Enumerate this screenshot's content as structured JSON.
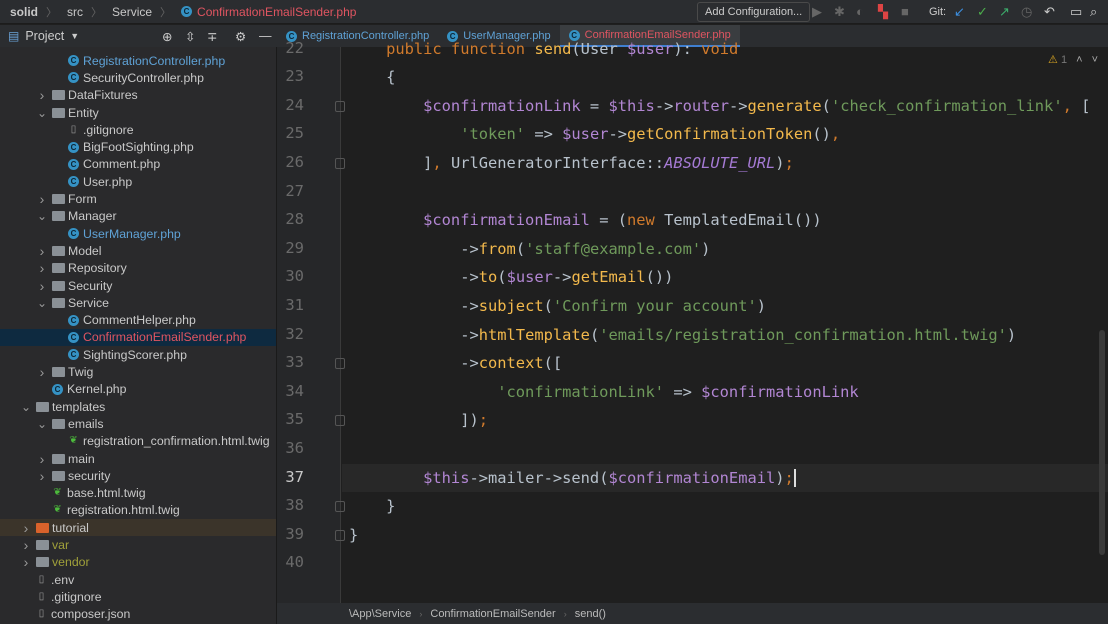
{
  "breadcrumb": [
    "solid",
    "src",
    "Service",
    "ConfirmationEmailSender.php"
  ],
  "toolbar": {
    "add_config": "Add Configuration...",
    "git_label": "Git:"
  },
  "project": {
    "title": "Project"
  },
  "tabs": [
    {
      "label": "RegistrationController.php",
      "active": false
    },
    {
      "label": "UserManager.php",
      "active": false
    },
    {
      "label": "ConfirmationEmailSender.php",
      "active": true
    }
  ],
  "inspection": {
    "warnings": "1"
  },
  "tree": [
    {
      "label": "RegistrationController.php",
      "level": 3,
      "type": "php",
      "color": "#5fa2d6"
    },
    {
      "label": "SecurityController.php",
      "level": 3,
      "type": "php"
    },
    {
      "label": "DataFixtures",
      "level": 2,
      "type": "folder",
      "open": false
    },
    {
      "label": "Entity",
      "level": 2,
      "type": "folder",
      "open": true
    },
    {
      "label": ".gitignore",
      "level": 3,
      "type": "file"
    },
    {
      "label": "BigFootSighting.php",
      "level": 3,
      "type": "php"
    },
    {
      "label": "Comment.php",
      "level": 3,
      "type": "php"
    },
    {
      "label": "User.php",
      "level": 3,
      "type": "php"
    },
    {
      "label": "Form",
      "level": 2,
      "type": "folder",
      "open": false
    },
    {
      "label": "Manager",
      "level": 2,
      "type": "folder",
      "open": true
    },
    {
      "label": "UserManager.php",
      "level": 3,
      "type": "php",
      "color": "#5fa2d6"
    },
    {
      "label": "Model",
      "level": 2,
      "type": "folder",
      "open": false
    },
    {
      "label": "Repository",
      "level": 2,
      "type": "folder",
      "open": false
    },
    {
      "label": "Security",
      "level": 2,
      "type": "folder",
      "open": false
    },
    {
      "label": "Service",
      "level": 2,
      "type": "folder",
      "open": true
    },
    {
      "label": "CommentHelper.php",
      "level": 3,
      "type": "php"
    },
    {
      "label": "ConfirmationEmailSender.php",
      "level": 3,
      "type": "php",
      "color": "#e05561",
      "selected": true
    },
    {
      "label": "SightingScorer.php",
      "level": 3,
      "type": "php"
    },
    {
      "label": "Twig",
      "level": 2,
      "type": "folder",
      "open": false
    },
    {
      "label": "Kernel.php",
      "level": 2,
      "type": "php"
    },
    {
      "label": "templates",
      "level": 1,
      "type": "folder",
      "open": true
    },
    {
      "label": "emails",
      "level": 2,
      "type": "folder",
      "open": true
    },
    {
      "label": "registration_confirmation.html.twig",
      "level": 3,
      "type": "twig"
    },
    {
      "label": "main",
      "level": 2,
      "type": "folder",
      "open": false
    },
    {
      "label": "security",
      "level": 2,
      "type": "folder",
      "open": false
    },
    {
      "label": "base.html.twig",
      "level": 2,
      "type": "twig"
    },
    {
      "label": "registration.html.twig",
      "level": 2,
      "type": "twig"
    },
    {
      "label": "tutorial",
      "level": 1,
      "type": "folder",
      "open": false,
      "orange": true,
      "highlight": true
    },
    {
      "label": "var",
      "level": 1,
      "type": "folder",
      "open": false,
      "color": "#a0a03a"
    },
    {
      "label": "vendor",
      "level": 1,
      "type": "folder",
      "open": false,
      "color": "#a0a03a"
    },
    {
      "label": ".env",
      "level": 1,
      "type": "file"
    },
    {
      "label": ".gitignore",
      "level": 1,
      "type": "file"
    },
    {
      "label": "composer.json",
      "level": 1,
      "type": "file"
    }
  ],
  "code": {
    "first_line": 22,
    "current_line": 37,
    "lines": [
      [
        [
          "kw",
          "    public function "
        ],
        [
          "fn",
          "send"
        ],
        [
          "def",
          "(User "
        ],
        [
          "var",
          "$user"
        ],
        [
          "def",
          "): "
        ],
        [
          "kw",
          "void"
        ]
      ],
      [
        [
          "def",
          "    {"
        ]
      ],
      [
        [
          "var",
          "        $confirmationLink"
        ],
        [
          "def",
          " = "
        ],
        [
          "var",
          "$this"
        ],
        [
          "def",
          "->"
        ],
        [
          "var",
          "router"
        ],
        [
          "def",
          "->"
        ],
        [
          "fn",
          "generate"
        ],
        [
          "def",
          "("
        ],
        [
          "str",
          "'check_confirmation_link'"
        ],
        [
          "pun",
          ", "
        ],
        [
          "def",
          "["
        ]
      ],
      [
        [
          "str",
          "            'token'"
        ],
        [
          "def",
          " => "
        ],
        [
          "var",
          "$user"
        ],
        [
          "def",
          "->"
        ],
        [
          "fn",
          "getConfirmationToken"
        ],
        [
          "def",
          "()"
        ],
        [
          "pun",
          ","
        ]
      ],
      [
        [
          "def",
          "        ]"
        ],
        [
          "pun",
          ", "
        ],
        [
          "def",
          "UrlGeneratorInterface::"
        ],
        [
          "const",
          "ABSOLUTE_URL"
        ],
        [
          "def",
          ")"
        ],
        [
          "pun",
          ";"
        ]
      ],
      [],
      [
        [
          "var",
          "        $confirmationEmail"
        ],
        [
          "def",
          " = ("
        ],
        [
          "kw",
          "new "
        ],
        [
          "def",
          "TemplatedEmail())"
        ]
      ],
      [
        [
          "def",
          "            ->"
        ],
        [
          "fn",
          "from"
        ],
        [
          "def",
          "("
        ],
        [
          "str",
          "'staff@example.com'"
        ],
        [
          "def",
          ")"
        ]
      ],
      [
        [
          "def",
          "            ->"
        ],
        [
          "fn",
          "to"
        ],
        [
          "def",
          "("
        ],
        [
          "var",
          "$user"
        ],
        [
          "def",
          "->"
        ],
        [
          "fn",
          "getEmail"
        ],
        [
          "def",
          "())"
        ]
      ],
      [
        [
          "def",
          "            ->"
        ],
        [
          "fn",
          "subject"
        ],
        [
          "def",
          "("
        ],
        [
          "str",
          "'Confirm your account'"
        ],
        [
          "def",
          ")"
        ]
      ],
      [
        [
          "def",
          "            ->"
        ],
        [
          "fn",
          "htmlTemplate"
        ],
        [
          "def",
          "("
        ],
        [
          "str",
          "'emails/registration_confirmation.html.twig'"
        ],
        [
          "def",
          ")"
        ]
      ],
      [
        [
          "def",
          "            ->"
        ],
        [
          "fn",
          "context"
        ],
        [
          "def",
          "(["
        ]
      ],
      [
        [
          "str",
          "                'confirmationLink'"
        ],
        [
          "def",
          " => "
        ],
        [
          "var",
          "$confirmationLink"
        ]
      ],
      [
        [
          "def",
          "            ])"
        ],
        [
          "pun",
          ";"
        ]
      ],
      [],
      [
        [
          "var",
          "        $this"
        ],
        [
          "def",
          "->mailer->send("
        ],
        [
          "var",
          "$confirmationEmail"
        ],
        [
          "def",
          ")"
        ],
        [
          "pun",
          ";"
        ]
      ],
      [
        [
          "def",
          "    }"
        ]
      ],
      [
        [
          "def",
          "}"
        ]
      ],
      []
    ]
  },
  "status_breadcrumb": [
    "\\App\\Service",
    "ConfirmationEmailSender",
    "send()"
  ]
}
